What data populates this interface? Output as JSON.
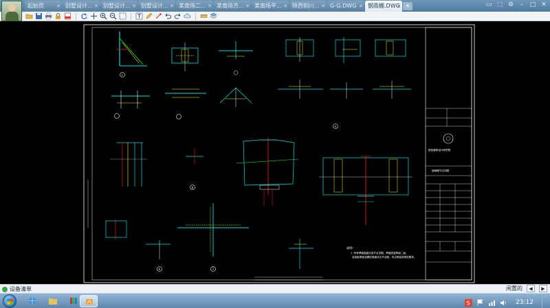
{
  "tabs": [
    {
      "label": "起始页",
      "active": false
    },
    {
      "label": "别墅设计...",
      "active": false
    },
    {
      "label": "别墅设计...",
      "active": false
    },
    {
      "label": "别墅设计...",
      "active": false
    },
    {
      "label": "某南场二...",
      "active": false
    },
    {
      "label": "某南场方...",
      "active": false
    },
    {
      "label": "某南场平...",
      "active": false
    },
    {
      "label": "陕西铜川...",
      "active": false
    },
    {
      "label": "G-G.DWG",
      "active": false
    },
    {
      "label": "钢雨棚.DWG",
      "active": true
    }
  ],
  "new_tab_label": "+",
  "window_controls": [
    "▭",
    "⬚",
    "⚙",
    "–",
    "□",
    "✕"
  ],
  "toolbar_icons": [
    "open-icon",
    "save-icon",
    "print-icon",
    "lock-icon",
    "pdf-icon",
    "rotate-icon",
    "pan-icon",
    "zoom-in-icon",
    "zoom-out-icon",
    "zoom-window-icon",
    "text-icon",
    "pencil-icon",
    "annotate-icon",
    "undo-icon",
    "redo-icon",
    "cloud-icon",
    "measure-icon",
    "layers-icon"
  ],
  "drawing": {
    "title_block": {
      "company_line1": "陕西建筑设计研究院",
      "drawing_title": "钢雨棚节点详图"
    },
    "notes_heading": "说明：",
    "note_line1": "1. 所有焊缝高度见各节点详图，焊缝质量等级二级，",
    "note_line2": "连接板厚度及螺栓规格详见节点图，未注明者按规范要求。",
    "detail_numbers": [
      "1",
      "2",
      "3",
      "4",
      "5",
      "6",
      "7",
      "8"
    ]
  },
  "status": {
    "text": "设备清单",
    "right_label": "闲置的"
  },
  "taskbar": {
    "clock": "23:12"
  },
  "colors": {
    "background": "#000000",
    "cad_white": "#ffffff",
    "cad_cyan": "#00e0e0",
    "cad_yellow": "#ffff00",
    "cad_red": "#ff2020",
    "cad_green": "#00ff00",
    "cad_magenta": "#ff40ff",
    "active_tab": "#ffffff"
  }
}
